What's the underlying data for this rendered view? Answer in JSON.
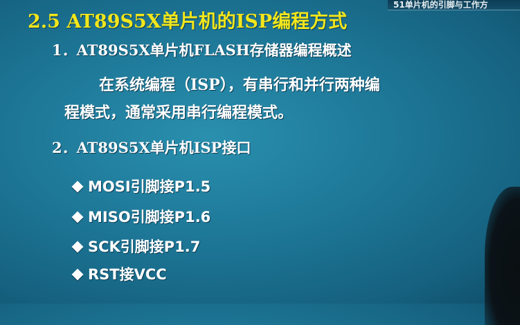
{
  "header": {
    "chapter_text": "51单片机的引脚与工作方"
  },
  "slide": {
    "title": "2.5  AT89S5X单片机的ISP编程方式",
    "section1": "1．AT89S5X单片机FLASH存储器编程概述",
    "paragraph_line1": "在系统编程（ISP），有串行和并行两种编",
    "paragraph_line2": "程模式，通常采用串行编程模式。",
    "section2": "2．AT89S5X单片机ISP接口",
    "bullets": [
      "MOSI引脚接P1.5",
      "MISO引脚接P1.6",
      "SCK引脚接P1.7",
      "RST接VCC"
    ]
  },
  "colors": {
    "background": "#1d7696",
    "title": "#f1e61c",
    "body_text": "#ffffff"
  },
  "icons": {
    "bullet": "diamond-bullet-icon"
  }
}
